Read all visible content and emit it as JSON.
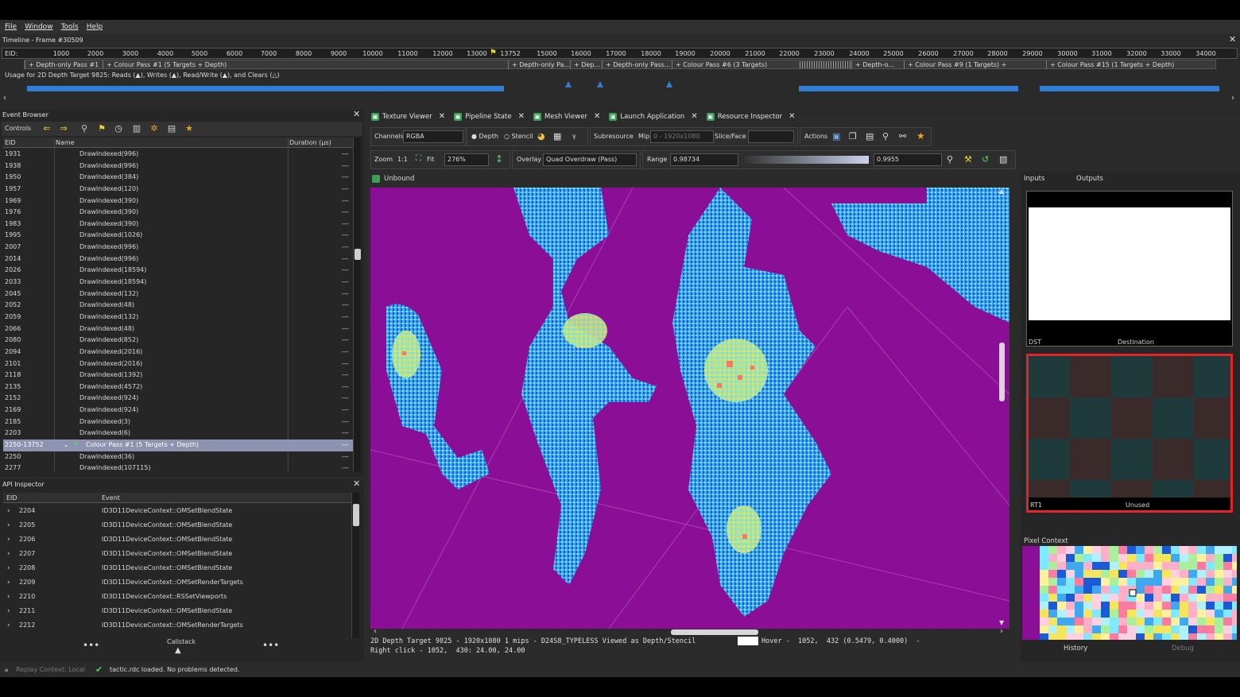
{
  "menu": [
    "File",
    "Window",
    "Tools",
    "Help"
  ],
  "timeline": {
    "title": "Timeline - Frame #30509",
    "eid_label": "EID:",
    "ticks": [
      "1000",
      "2000",
      "3000",
      "4000",
      "5000",
      "6000",
      "7000",
      "8000",
      "9000",
      "10000",
      "11000",
      "12000",
      "13000",
      "13752",
      "15000",
      "16000",
      "17000",
      "18000",
      "19000",
      "20000",
      "21000",
      "22000",
      "23000",
      "24000",
      "25000",
      "26000",
      "27000",
      "28000",
      "29000",
      "30000",
      "31000",
      "32000",
      "33000",
      "34000"
    ],
    "passes": [
      "+ Depth-only Pass #1",
      "+ Colour Pass #1 (5 Targets + Depth)",
      "+ Depth-only Pa...",
      "+ Dep...",
      "+ Depth-only Pass...",
      "+ Colour Pass #6 (3 Targets)",
      "+ Depth-o...",
      "+ Colour Pass #9 (1 Targets) +",
      "+ Colour Pass #15 (1 Targets + Depth)"
    ],
    "usage": "Usage for 2D Depth Target 9825: Reads (▲), Writes (▲), Read/Write (▲), and Clears (△)"
  },
  "event_browser": {
    "title": "Event Browser",
    "controls": "Controls",
    "columns": {
      "eid": "EID",
      "name": "Name",
      "duration": "Duration (µs)"
    },
    "rows": [
      {
        "eid": "1931",
        "name": "DrawIndexed(996)",
        "dur": "---"
      },
      {
        "eid": "1938",
        "name": "DrawIndexed(996)",
        "dur": "---"
      },
      {
        "eid": "1950",
        "name": "DrawIndexed(384)",
        "dur": "---"
      },
      {
        "eid": "1957",
        "name": "DrawIndexed(120)",
        "dur": "---"
      },
      {
        "eid": "1969",
        "name": "DrawIndexed(390)",
        "dur": "---"
      },
      {
        "eid": "1976",
        "name": "DrawIndexed(390)",
        "dur": "---"
      },
      {
        "eid": "1983",
        "name": "DrawIndexed(390)",
        "dur": "---"
      },
      {
        "eid": "1995",
        "name": "DrawIndexed(1026)",
        "dur": "---"
      },
      {
        "eid": "2007",
        "name": "DrawIndexed(996)",
        "dur": "---"
      },
      {
        "eid": "2014",
        "name": "DrawIndexed(996)",
        "dur": "---"
      },
      {
        "eid": "2026",
        "name": "DrawIndexed(18594)",
        "dur": "---"
      },
      {
        "eid": "2033",
        "name": "DrawIndexed(18594)",
        "dur": "---"
      },
      {
        "eid": "2045",
        "name": "DrawIndexed(132)",
        "dur": "---"
      },
      {
        "eid": "2052",
        "name": "DrawIndexed(48)",
        "dur": "---"
      },
      {
        "eid": "2059",
        "name": "DrawIndexed(132)",
        "dur": "---"
      },
      {
        "eid": "2066",
        "name": "DrawIndexed(48)",
        "dur": "---"
      },
      {
        "eid": "2080",
        "name": "DrawIndexed(852)",
        "dur": "---"
      },
      {
        "eid": "2094",
        "name": "DrawIndexed(2016)",
        "dur": "---"
      },
      {
        "eid": "2101",
        "name": "DrawIndexed(2016)",
        "dur": "---"
      },
      {
        "eid": "2118",
        "name": "DrawIndexed(1392)",
        "dur": "---"
      },
      {
        "eid": "2135",
        "name": "DrawIndexed(4572)",
        "dur": "---"
      },
      {
        "eid": "2152",
        "name": "DrawIndexed(924)",
        "dur": "---"
      },
      {
        "eid": "2169",
        "name": "DrawIndexed(924)",
        "dur": "---"
      },
      {
        "eid": "2185",
        "name": "DrawIndexed(3)",
        "dur": "---"
      },
      {
        "eid": "2203",
        "name": "DrawIndexed(6)",
        "dur": "---"
      },
      {
        "eid": "2250-13752",
        "name": "Colour Pass #1 (5 Targets + Depth)",
        "dur": "---",
        "selected": true
      },
      {
        "eid": "2250",
        "name": "DrawIndexed(36)",
        "dur": "---"
      },
      {
        "eid": "2277",
        "name": "DrawIndexed(107115)",
        "dur": "---"
      }
    ]
  },
  "api_inspector": {
    "title": "API Inspector",
    "columns": {
      "eid": "EID",
      "event": "Event"
    },
    "rows": [
      {
        "eid": "2204",
        "event": "ID3D11DeviceContext::OMSetBlendState"
      },
      {
        "eid": "2205",
        "event": "ID3D11DeviceContext::OMSetBlendState"
      },
      {
        "eid": "2206",
        "event": "ID3D11DeviceContext::OMSetBlendState"
      },
      {
        "eid": "2207",
        "event": "ID3D11DeviceContext::OMSetBlendState"
      },
      {
        "eid": "2208",
        "event": "ID3D11DeviceContext::OMSetBlendState"
      },
      {
        "eid": "2209",
        "event": "ID3D11DeviceContext::OMSetRenderTargets"
      },
      {
        "eid": "2210",
        "event": "ID3D11DeviceContext::RSSetViewports"
      },
      {
        "eid": "2211",
        "event": "ID3D11DeviceContext::OMSetBlendState"
      },
      {
        "eid": "2212",
        "event": "ID3D11DeviceContext::OMSetRenderTargets"
      }
    ],
    "callstack": "Callstack"
  },
  "tabs": [
    "Texture Viewer",
    "Pipeline State",
    "Mesh Viewer",
    "Launch Application",
    "Resource Inspector"
  ],
  "texture_toolbar": {
    "channels_label": "Channels",
    "channels_value": "RGBA",
    "depth": "Depth",
    "stencil": "Stencil",
    "subresource": "Subresource",
    "mip_label": "Mip",
    "mip_value": "0 - 1920x1080",
    "slice_label": "Slice/Face",
    "actions": "Actions",
    "zoom_label": "Zoom",
    "zoom_1to1": "1:1",
    "fit": "Fit",
    "zoom_value": "276%",
    "overlay_label": "Overlay",
    "overlay_value": "Quad Overdraw (Pass)",
    "range_label": "Range",
    "range_min": "0.98734",
    "range_max": "0.9955",
    "unbound": "Unbound"
  },
  "status": {
    "line1": "2D Depth Target 9825 - 1920x1080 1 mips - D24S8_TYPELESS Viewed as Depth/Stencil",
    "line1b": "Hover -  1052,  432 (0.5479, 0.4000)  -",
    "line2": "Right click - 1052,  430: 24.00, 24.00"
  },
  "right_panel": {
    "inputs": "Inputs",
    "outputs": "Outputs",
    "dst_label": "DST",
    "dst_name": "Destination",
    "rt_label": "RT1",
    "rt_name": "Unused",
    "pixel_context": "Pixel Context",
    "history": "History",
    "debug": "Debug"
  },
  "bottom": {
    "replay": "Replay Context: Local",
    "message": "tactic.rdc loaded. No problems detected."
  },
  "colors": {
    "accent": "#2f7fd6",
    "overdraw_bg": "#8b0f96",
    "selection": "#8e93b0",
    "rt_border": "#e0242c"
  }
}
